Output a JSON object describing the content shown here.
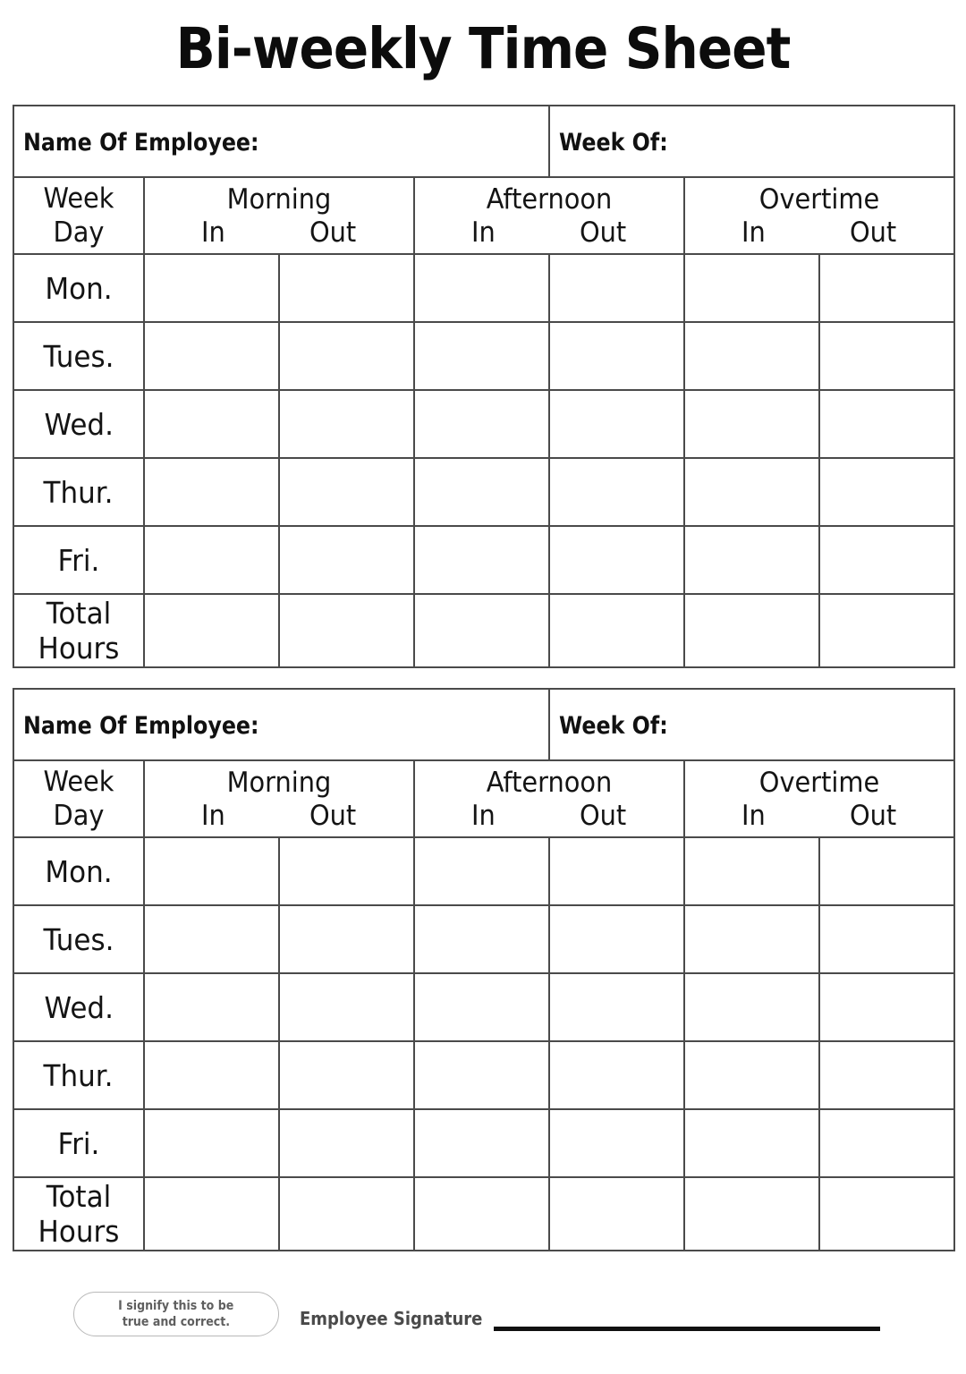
{
  "document": {
    "title": "Bi-weekly Time Sheet"
  },
  "sheets": [
    {
      "id": "sheet-1",
      "name_label": "Name Of Employee:",
      "week_label": "Week Of:",
      "daycol_header": {
        "line1": "Week",
        "line2": "Day"
      },
      "groups": [
        {
          "title": "Morning",
          "in": "In",
          "out": "Out"
        },
        {
          "title": "Afternoon",
          "in": "In",
          "out": "Out"
        },
        {
          "title": "Overtime",
          "in": "In",
          "out": "Out"
        }
      ],
      "rows": [
        {
          "day": "Mon."
        },
        {
          "day": "Tues."
        },
        {
          "day": "Wed."
        },
        {
          "day": "Thur."
        },
        {
          "day": "Fri."
        }
      ],
      "total_row": {
        "line1": "Total",
        "line2": "Hours"
      }
    },
    {
      "id": "sheet-2",
      "name_label": "Name Of Employee:",
      "week_label": "Week Of:",
      "daycol_header": {
        "line1": "Week",
        "line2": "Day"
      },
      "groups": [
        {
          "title": "Morning",
          "in": "In",
          "out": "Out"
        },
        {
          "title": "Afternoon",
          "in": "In",
          "out": "Out"
        },
        {
          "title": "Overtime",
          "in": "In",
          "out": "Out"
        }
      ],
      "rows": [
        {
          "day": "Mon."
        },
        {
          "day": "Tues."
        },
        {
          "day": "Wed."
        },
        {
          "day": "Thur."
        },
        {
          "day": "Fri."
        }
      ],
      "total_row": {
        "line1": "Total",
        "line2": "Hours"
      }
    }
  ],
  "footer": {
    "pledge_line1": "I signify this to be",
    "pledge_line2": "true and correct.",
    "signature_label": "Employee Signature"
  },
  "colors": {
    "ink": "#111111",
    "rule": "#4a4a4a",
    "muted_text": "#5f5f5f",
    "paper": "#ffffff"
  }
}
